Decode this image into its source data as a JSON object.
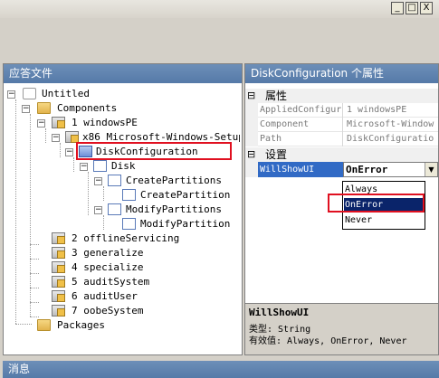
{
  "window": {
    "minimize_glyph": "_",
    "maximize_glyph": "□",
    "close_glyph": "X"
  },
  "left_panel": {
    "title": "应答文件",
    "tree": {
      "root": "Untitled",
      "components": "Components",
      "pass1": "1 windowsPE",
      "component": "x86_Microsoft-Windows-Setup_",
      "disk_config": "DiskConfiguration",
      "disk": "Disk",
      "create_partitions": "CreatePartitions",
      "create_partition": "CreatePartition",
      "modify_partitions": "ModifyPartitions",
      "modify_partition": "ModifyPartition",
      "pass2": "2 offlineServicing",
      "pass3": "3 generalize",
      "pass4": "4 specialize",
      "pass5": "5 auditSystem",
      "pass6": "6 auditUser",
      "pass7": "7 oobeSystem",
      "packages": "Packages"
    }
  },
  "right_panel": {
    "title": "DiskConfiguration 个属性",
    "section_properties": "属性",
    "properties": [
      {
        "name": "AppliedConfigur",
        "value": "1 windowsPE"
      },
      {
        "name": "Component",
        "value": "Microsoft-Window"
      },
      {
        "name": "Path",
        "value": "DiskConfiguratio"
      }
    ],
    "section_settings": "设置",
    "setting_name": "WillShowUI",
    "setting_value": "OnError",
    "dropdown_options": [
      "Always",
      "OnError",
      "Never"
    ],
    "help_title": "WillShowUI",
    "help_type": "类型: String",
    "help_values": "有效值: Always, OnError, Never"
  },
  "messages": {
    "title": "消息"
  }
}
